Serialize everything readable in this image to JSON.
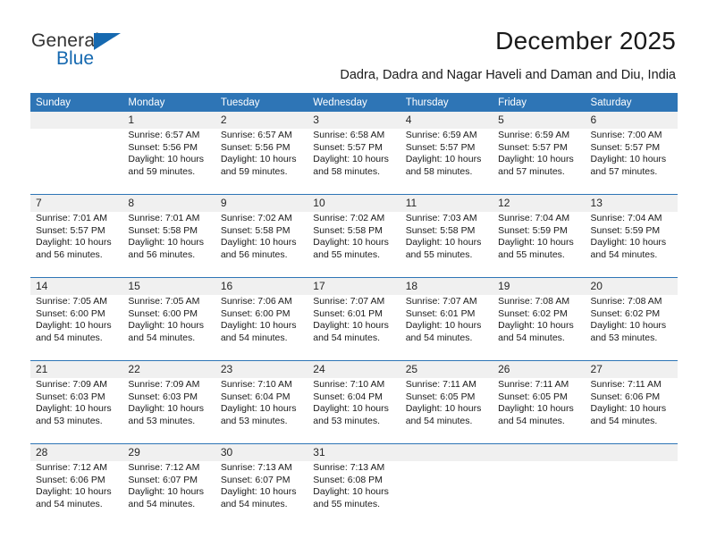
{
  "brand": {
    "name_part1": "General",
    "name_part2": "Blue",
    "accent_color": "#1669b0",
    "logo_icon": "triangle-flag-icon"
  },
  "header": {
    "title": "December 2025",
    "subtitle": "Dadra, Dadra and Nagar Haveli and Daman and Diu, India"
  },
  "theme": {
    "header_bg": "#2e75b6",
    "daynum_bg": "#f0f0f0",
    "separator": "#2e75b6",
    "text": "#1a1a1a"
  },
  "calendar": {
    "weekdays": [
      "Sunday",
      "Monday",
      "Tuesday",
      "Wednesday",
      "Thursday",
      "Friday",
      "Saturday"
    ],
    "weeks": [
      [
        {
          "day": "",
          "sunrise": "",
          "sunset": "",
          "daylight1": "",
          "daylight2": ""
        },
        {
          "day": "1",
          "sunrise": "Sunrise: 6:57 AM",
          "sunset": "Sunset: 5:56 PM",
          "daylight1": "Daylight: 10 hours",
          "daylight2": "and 59 minutes."
        },
        {
          "day": "2",
          "sunrise": "Sunrise: 6:57 AM",
          "sunset": "Sunset: 5:56 PM",
          "daylight1": "Daylight: 10 hours",
          "daylight2": "and 59 minutes."
        },
        {
          "day": "3",
          "sunrise": "Sunrise: 6:58 AM",
          "sunset": "Sunset: 5:57 PM",
          "daylight1": "Daylight: 10 hours",
          "daylight2": "and 58 minutes."
        },
        {
          "day": "4",
          "sunrise": "Sunrise: 6:59 AM",
          "sunset": "Sunset: 5:57 PM",
          "daylight1": "Daylight: 10 hours",
          "daylight2": "and 58 minutes."
        },
        {
          "day": "5",
          "sunrise": "Sunrise: 6:59 AM",
          "sunset": "Sunset: 5:57 PM",
          "daylight1": "Daylight: 10 hours",
          "daylight2": "and 57 minutes."
        },
        {
          "day": "6",
          "sunrise": "Sunrise: 7:00 AM",
          "sunset": "Sunset: 5:57 PM",
          "daylight1": "Daylight: 10 hours",
          "daylight2": "and 57 minutes."
        }
      ],
      [
        {
          "day": "7",
          "sunrise": "Sunrise: 7:01 AM",
          "sunset": "Sunset: 5:57 PM",
          "daylight1": "Daylight: 10 hours",
          "daylight2": "and 56 minutes."
        },
        {
          "day": "8",
          "sunrise": "Sunrise: 7:01 AM",
          "sunset": "Sunset: 5:58 PM",
          "daylight1": "Daylight: 10 hours",
          "daylight2": "and 56 minutes."
        },
        {
          "day": "9",
          "sunrise": "Sunrise: 7:02 AM",
          "sunset": "Sunset: 5:58 PM",
          "daylight1": "Daylight: 10 hours",
          "daylight2": "and 56 minutes."
        },
        {
          "day": "10",
          "sunrise": "Sunrise: 7:02 AM",
          "sunset": "Sunset: 5:58 PM",
          "daylight1": "Daylight: 10 hours",
          "daylight2": "and 55 minutes."
        },
        {
          "day": "11",
          "sunrise": "Sunrise: 7:03 AM",
          "sunset": "Sunset: 5:58 PM",
          "daylight1": "Daylight: 10 hours",
          "daylight2": "and 55 minutes."
        },
        {
          "day": "12",
          "sunrise": "Sunrise: 7:04 AM",
          "sunset": "Sunset: 5:59 PM",
          "daylight1": "Daylight: 10 hours",
          "daylight2": "and 55 minutes."
        },
        {
          "day": "13",
          "sunrise": "Sunrise: 7:04 AM",
          "sunset": "Sunset: 5:59 PM",
          "daylight1": "Daylight: 10 hours",
          "daylight2": "and 54 minutes."
        }
      ],
      [
        {
          "day": "14",
          "sunrise": "Sunrise: 7:05 AM",
          "sunset": "Sunset: 6:00 PM",
          "daylight1": "Daylight: 10 hours",
          "daylight2": "and 54 minutes."
        },
        {
          "day": "15",
          "sunrise": "Sunrise: 7:05 AM",
          "sunset": "Sunset: 6:00 PM",
          "daylight1": "Daylight: 10 hours",
          "daylight2": "and 54 minutes."
        },
        {
          "day": "16",
          "sunrise": "Sunrise: 7:06 AM",
          "sunset": "Sunset: 6:00 PM",
          "daylight1": "Daylight: 10 hours",
          "daylight2": "and 54 minutes."
        },
        {
          "day": "17",
          "sunrise": "Sunrise: 7:07 AM",
          "sunset": "Sunset: 6:01 PM",
          "daylight1": "Daylight: 10 hours",
          "daylight2": "and 54 minutes."
        },
        {
          "day": "18",
          "sunrise": "Sunrise: 7:07 AM",
          "sunset": "Sunset: 6:01 PM",
          "daylight1": "Daylight: 10 hours",
          "daylight2": "and 54 minutes."
        },
        {
          "day": "19",
          "sunrise": "Sunrise: 7:08 AM",
          "sunset": "Sunset: 6:02 PM",
          "daylight1": "Daylight: 10 hours",
          "daylight2": "and 54 minutes."
        },
        {
          "day": "20",
          "sunrise": "Sunrise: 7:08 AM",
          "sunset": "Sunset: 6:02 PM",
          "daylight1": "Daylight: 10 hours",
          "daylight2": "and 53 minutes."
        }
      ],
      [
        {
          "day": "21",
          "sunrise": "Sunrise: 7:09 AM",
          "sunset": "Sunset: 6:03 PM",
          "daylight1": "Daylight: 10 hours",
          "daylight2": "and 53 minutes."
        },
        {
          "day": "22",
          "sunrise": "Sunrise: 7:09 AM",
          "sunset": "Sunset: 6:03 PM",
          "daylight1": "Daylight: 10 hours",
          "daylight2": "and 53 minutes."
        },
        {
          "day": "23",
          "sunrise": "Sunrise: 7:10 AM",
          "sunset": "Sunset: 6:04 PM",
          "daylight1": "Daylight: 10 hours",
          "daylight2": "and 53 minutes."
        },
        {
          "day": "24",
          "sunrise": "Sunrise: 7:10 AM",
          "sunset": "Sunset: 6:04 PM",
          "daylight1": "Daylight: 10 hours",
          "daylight2": "and 53 minutes."
        },
        {
          "day": "25",
          "sunrise": "Sunrise: 7:11 AM",
          "sunset": "Sunset: 6:05 PM",
          "daylight1": "Daylight: 10 hours",
          "daylight2": "and 54 minutes."
        },
        {
          "day": "26",
          "sunrise": "Sunrise: 7:11 AM",
          "sunset": "Sunset: 6:05 PM",
          "daylight1": "Daylight: 10 hours",
          "daylight2": "and 54 minutes."
        },
        {
          "day": "27",
          "sunrise": "Sunrise: 7:11 AM",
          "sunset": "Sunset: 6:06 PM",
          "daylight1": "Daylight: 10 hours",
          "daylight2": "and 54 minutes."
        }
      ],
      [
        {
          "day": "28",
          "sunrise": "Sunrise: 7:12 AM",
          "sunset": "Sunset: 6:06 PM",
          "daylight1": "Daylight: 10 hours",
          "daylight2": "and 54 minutes."
        },
        {
          "day": "29",
          "sunrise": "Sunrise: 7:12 AM",
          "sunset": "Sunset: 6:07 PM",
          "daylight1": "Daylight: 10 hours",
          "daylight2": "and 54 minutes."
        },
        {
          "day": "30",
          "sunrise": "Sunrise: 7:13 AM",
          "sunset": "Sunset: 6:07 PM",
          "daylight1": "Daylight: 10 hours",
          "daylight2": "and 54 minutes."
        },
        {
          "day": "31",
          "sunrise": "Sunrise: 7:13 AM",
          "sunset": "Sunset: 6:08 PM",
          "daylight1": "Daylight: 10 hours",
          "daylight2": "and 55 minutes."
        },
        {
          "day": "",
          "sunrise": "",
          "sunset": "",
          "daylight1": "",
          "daylight2": ""
        },
        {
          "day": "",
          "sunrise": "",
          "sunset": "",
          "daylight1": "",
          "daylight2": ""
        },
        {
          "day": "",
          "sunrise": "",
          "sunset": "",
          "daylight1": "",
          "daylight2": ""
        }
      ]
    ]
  }
}
